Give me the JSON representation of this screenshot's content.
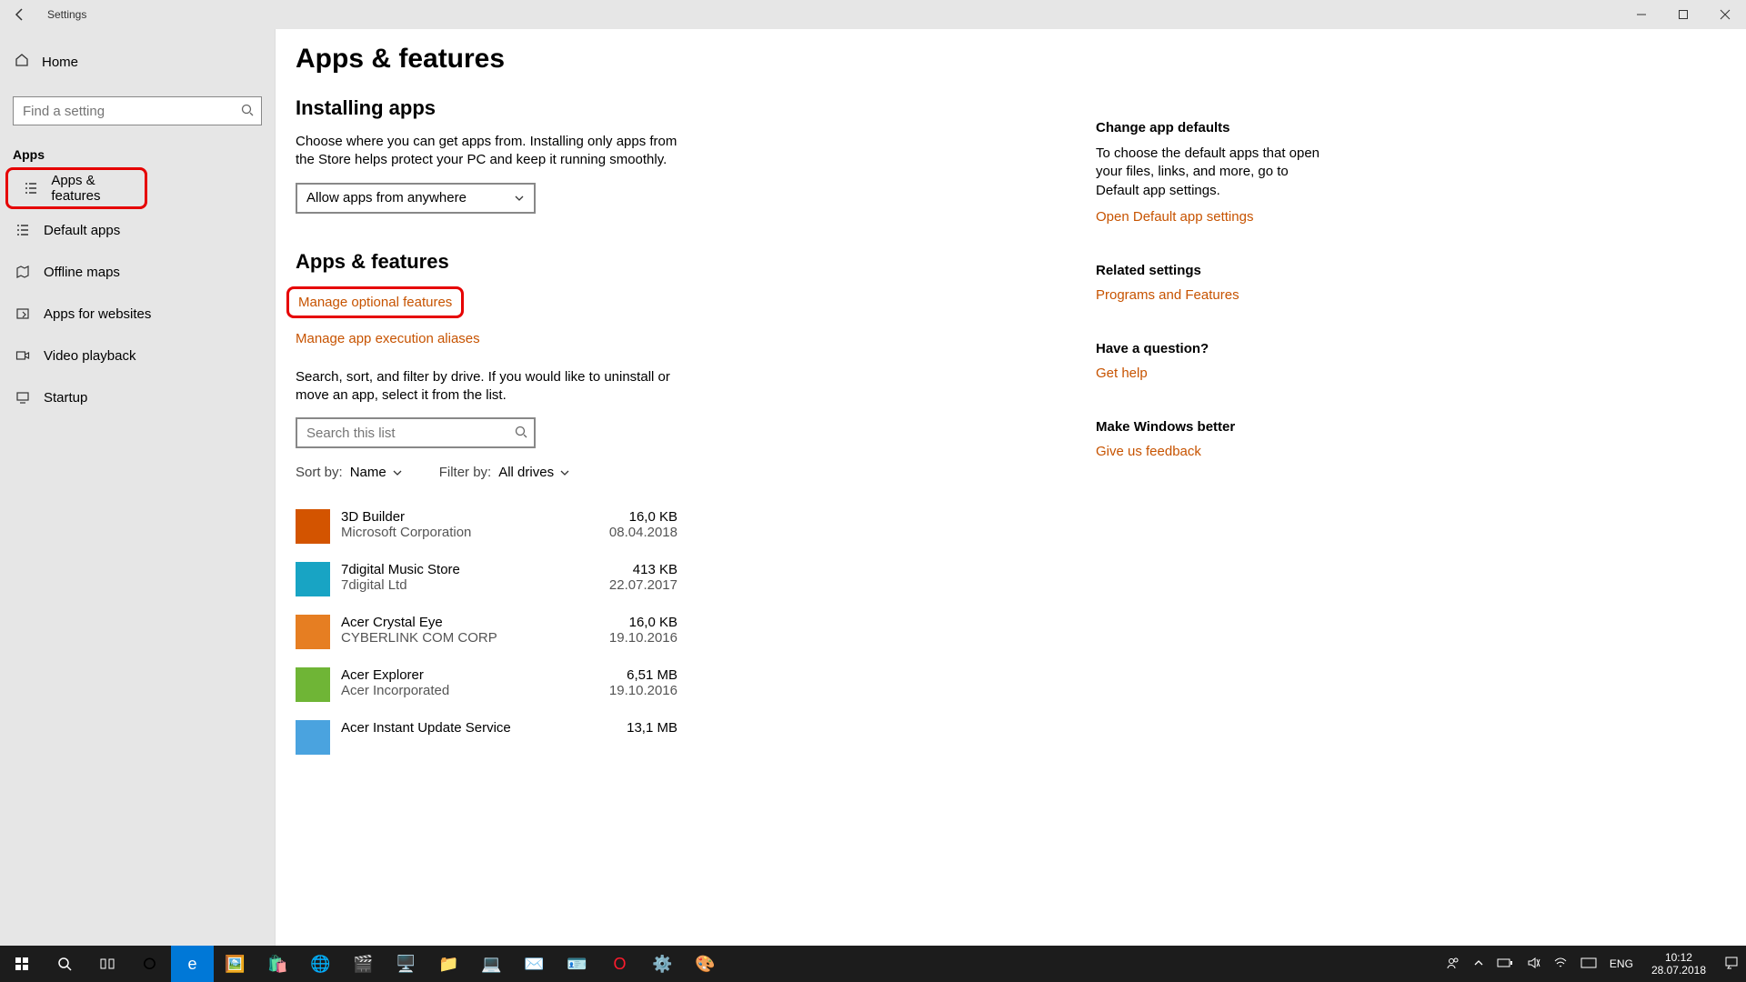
{
  "window": {
    "title": "Settings"
  },
  "sidebar": {
    "home": "Home",
    "search_placeholder": "Find a setting",
    "section": "Apps",
    "items": [
      {
        "label": "Apps & features",
        "selected": true
      },
      {
        "label": "Default apps"
      },
      {
        "label": "Offline maps"
      },
      {
        "label": "Apps for websites"
      },
      {
        "label": "Video playback"
      },
      {
        "label": "Startup"
      }
    ]
  },
  "main": {
    "page_title": "Apps & features",
    "installing": {
      "title": "Installing apps",
      "desc": "Choose where you can get apps from. Installing only apps from the Store helps protect your PC and keep it running smoothly.",
      "select_value": "Allow apps from anywhere"
    },
    "apps_features": {
      "title": "Apps & features",
      "link_optional": "Manage optional features",
      "link_aliases": "Manage app execution aliases",
      "desc": "Search, sort, and filter by drive. If you would like to uninstall or move an app, select it from the list.",
      "search_placeholder": "Search this list",
      "sort_label": "Sort by:",
      "sort_value": "Name",
      "filter_label": "Filter by:",
      "filter_value": "All drives"
    },
    "apps": [
      {
        "name": "3D Builder",
        "publisher": "Microsoft Corporation",
        "size": "16,0 KB",
        "date": "08.04.2018",
        "color": "#d35400"
      },
      {
        "name": "7digital Music Store",
        "publisher": "7digital Ltd",
        "size": "413 KB",
        "date": "22.07.2017",
        "color": "#18a4c4"
      },
      {
        "name": "Acer Crystal Eye",
        "publisher": "CYBERLINK COM CORP",
        "size": "16,0 KB",
        "date": "19.10.2016",
        "color": "#e67e22"
      },
      {
        "name": "Acer Explorer",
        "publisher": "Acer Incorporated",
        "size": "6,51 MB",
        "date": "19.10.2016",
        "color": "#6fb536"
      },
      {
        "name": "Acer Instant Update Service",
        "publisher": "",
        "size": "13,1 MB",
        "date": "",
        "color": "#4aa3df"
      }
    ]
  },
  "rail": {
    "defaults": {
      "title": "Change app defaults",
      "desc": "To choose the default apps that open your files, links, and more, go to Default app settings.",
      "link": "Open Default app settings"
    },
    "related": {
      "title": "Related settings",
      "link": "Programs and Features"
    },
    "question": {
      "title": "Have a question?",
      "link": "Get help"
    },
    "better": {
      "title": "Make Windows better",
      "link": "Give us feedback"
    }
  },
  "taskbar": {
    "lang": "ENG",
    "time": "10:12",
    "date": "28.07.2018"
  }
}
